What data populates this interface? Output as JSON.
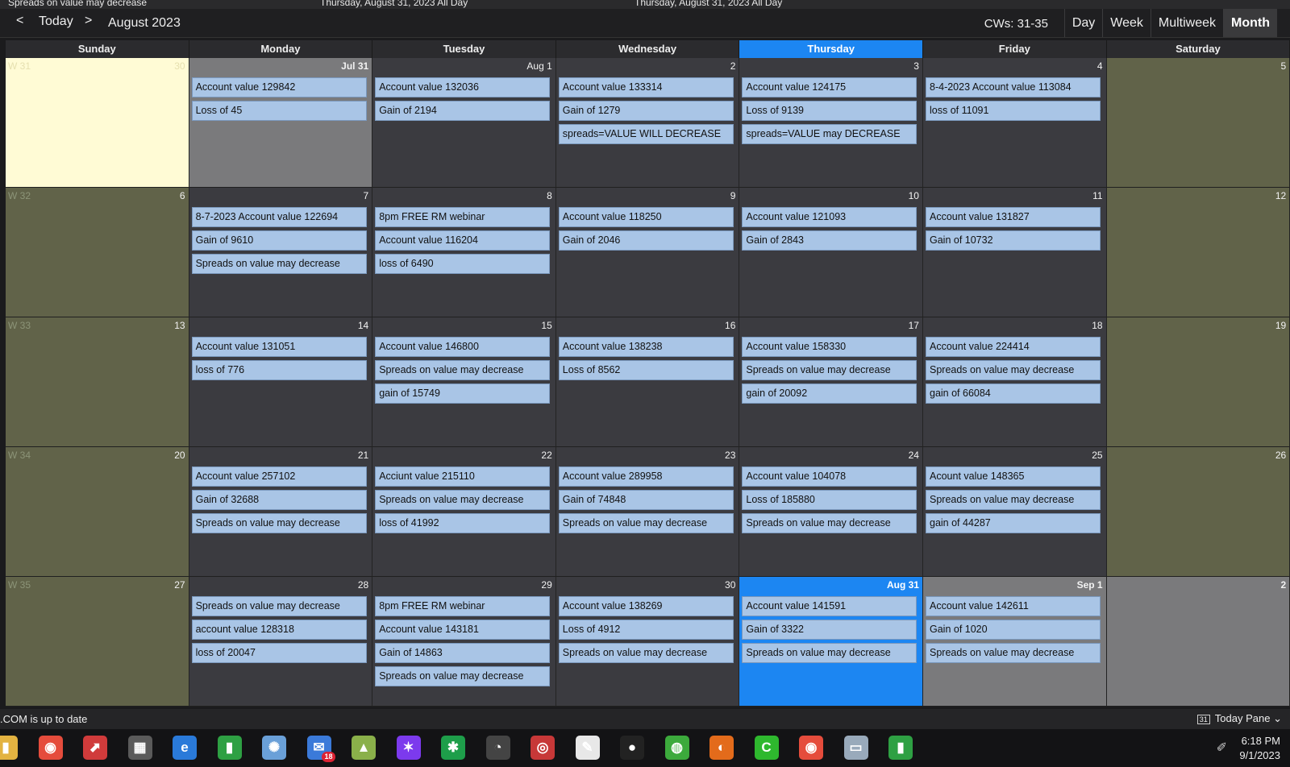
{
  "top_strip": [
    "Spreads on value may decrease",
    "Thursday, August 31, 2023 All Day",
    "Thursday, August 31, 2023 All Day"
  ],
  "nav": {
    "prev": "<",
    "today": "Today",
    "next": ">",
    "month_title": "August 2023",
    "cws": "CWs: 31-35"
  },
  "views": [
    "Day",
    "Week",
    "Multiweek",
    "Month"
  ],
  "active_view": "Month",
  "day_headers": [
    "Sunday",
    "Monday",
    "Tuesday",
    "Wednesday",
    "Thursday",
    "Friday",
    "Saturday"
  ],
  "today_column": "Thursday",
  "colors": {
    "today": "#1c86f2",
    "event": "#a9c5e6",
    "weekend": "#616349",
    "other_month": "#7a7a7c",
    "weekday": "#3b3b40",
    "today_fill": "#fffbd5"
  },
  "weeks": [
    {
      "label": "W 31",
      "days": [
        {
          "date": "30",
          "state": "other-today",
          "events": []
        },
        {
          "date": "Jul 31",
          "state": "other",
          "events": [
            "Account value 129842",
            "Loss of 45"
          ]
        },
        {
          "date": "Aug 1",
          "state": "normal",
          "events": [
            "Account value 132036",
            "Gain of 2194"
          ]
        },
        {
          "date": "2",
          "state": "normal",
          "events": [
            "Account value 133314",
            "Gain of 1279",
            "spreads=VALUE WILL DECREASE"
          ]
        },
        {
          "date": "3",
          "state": "normal",
          "events": [
            "Account value 124175",
            "Loss of 9139",
            "spreads=VALUE may DECREASE"
          ]
        },
        {
          "date": "4",
          "state": "normal",
          "events": [
            "8-4-2023 Account value 113084",
            "loss of 11091"
          ]
        },
        {
          "date": "5",
          "state": "weekend",
          "events": []
        }
      ]
    },
    {
      "label": "W 32",
      "days": [
        {
          "date": "6",
          "state": "weekend",
          "events": []
        },
        {
          "date": "7",
          "state": "normal",
          "events": [
            "8-7-2023 Account value 122694",
            "Gain of 9610",
            "Spreads on value may decrease"
          ]
        },
        {
          "date": "8",
          "state": "normal",
          "events": [
            "8pm FREE RM webinar",
            "Account value 116204",
            "loss of 6490"
          ]
        },
        {
          "date": "9",
          "state": "normal",
          "events": [
            "Account value 118250",
            "Gain of 2046"
          ]
        },
        {
          "date": "10",
          "state": "normal",
          "events": [
            "Account value 121093",
            "Gain of 2843"
          ]
        },
        {
          "date": "11",
          "state": "normal",
          "events": [
            "Account value 131827",
            "Gain of 10732"
          ]
        },
        {
          "date": "12",
          "state": "weekend",
          "events": []
        }
      ]
    },
    {
      "label": "W 33",
      "days": [
        {
          "date": "13",
          "state": "weekend",
          "events": []
        },
        {
          "date": "14",
          "state": "normal",
          "events": [
            "Account value 131051",
            "loss of 776"
          ]
        },
        {
          "date": "15",
          "state": "normal",
          "events": [
            "Account value 146800",
            "Spreads on value may decrease",
            "gain of 15749"
          ]
        },
        {
          "date": "16",
          "state": "normal",
          "events": [
            "Account value 138238",
            "Loss of 8562"
          ]
        },
        {
          "date": "17",
          "state": "normal",
          "events": [
            "Account value 158330",
            "Spreads on value may decrease",
            "gain of 20092"
          ]
        },
        {
          "date": "18",
          "state": "normal",
          "events": [
            "Account value 224414",
            "Spreads on value may decrease",
            "gain of 66084"
          ]
        },
        {
          "date": "19",
          "state": "weekend",
          "events": []
        }
      ]
    },
    {
      "label": "W 34",
      "days": [
        {
          "date": "20",
          "state": "weekend",
          "events": []
        },
        {
          "date": "21",
          "state": "normal",
          "events": [
            "Account value 257102",
            "Gain of 32688",
            "Spreads on value may decrease"
          ]
        },
        {
          "date": "22",
          "state": "normal",
          "events": [
            "Acciunt value 215110",
            "Spreads on value may decrease",
            "loss of 41992"
          ]
        },
        {
          "date": "23",
          "state": "normal",
          "events": [
            "Account value 289958",
            "Gain of 74848",
            "Spreads on value may decrease"
          ]
        },
        {
          "date": "24",
          "state": "normal",
          "events": [
            "Account value 104078",
            "Loss of 185880",
            "Spreads on value may decrease"
          ]
        },
        {
          "date": "25",
          "state": "normal",
          "events": [
            "Acount value 148365",
            "Spreads on value may decrease",
            "gain of 44287"
          ]
        },
        {
          "date": "26",
          "state": "weekend",
          "events": []
        }
      ]
    },
    {
      "label": "W 35",
      "days": [
        {
          "date": "27",
          "state": "weekend",
          "events": []
        },
        {
          "date": "28",
          "state": "normal",
          "events": [
            "Spreads on value may decrease",
            "account value 128318",
            "loss of 20047"
          ]
        },
        {
          "date": "29",
          "state": "normal",
          "events": [
            "8pm FREE RM webinar",
            "Account value 143181",
            "Gain of 14863",
            "Spreads on value may decrease"
          ]
        },
        {
          "date": "30",
          "state": "normal",
          "events": [
            "Account value 138269",
            "Loss of 4912",
            "Spreads on value may decrease"
          ]
        },
        {
          "date": "Aug 31",
          "state": "today",
          "events": [
            "Account value 141591",
            "Gain of 3322",
            "Spreads on value may decrease"
          ]
        },
        {
          "date": "Sep 1",
          "state": "other",
          "events": [
            "Account value 142611",
            "Gain of 1020",
            "Spreads on value may decrease"
          ]
        },
        {
          "date": "2",
          "state": "other",
          "events": []
        }
      ]
    }
  ],
  "status": {
    "message": ".COM is up to date",
    "today_pane": "Today Pane",
    "today_pane_icon": "calendar-31-icon"
  },
  "taskbar": {
    "apps": [
      {
        "name": "file-explorer-icon",
        "glyph": "▮",
        "color": "#e3b341"
      },
      {
        "name": "chrome-icon",
        "glyph": "◉",
        "color": "#e54c3c"
      },
      {
        "name": "pdf-app-icon",
        "glyph": "⬈",
        "color": "#d03b3b"
      },
      {
        "name": "calendar-321-icon",
        "glyph": "▦",
        "color": "#5a5a5a"
      },
      {
        "name": "edge-icon",
        "glyph": "e",
        "color": "#2a7ad9"
      },
      {
        "name": "trading-chart-icon",
        "glyph": "▮",
        "color": "#2ea043"
      },
      {
        "name": "brain-app-icon",
        "glyph": "✺",
        "color": "#6aa0d8"
      },
      {
        "name": "thunderbird-icon",
        "glyph": "✉",
        "color": "#3b7ad9"
      },
      {
        "name": "map-app-icon",
        "glyph": "▲",
        "color": "#8ab04a"
      },
      {
        "name": "puzzle-app-icon",
        "glyph": "✶",
        "color": "#7c3aed"
      },
      {
        "name": "green-star-icon",
        "glyph": "✱",
        "color": "#1e9e4a"
      },
      {
        "name": "speedometer-icon",
        "glyph": "◔",
        "color": "#444"
      },
      {
        "name": "shield-icon",
        "glyph": "◎",
        "color": "#c73838"
      },
      {
        "name": "acrobat-icon",
        "glyph": "✎",
        "color": "#e8e8e8"
      },
      {
        "name": "bulb-icon",
        "glyph": "●",
        "color": "#222"
      },
      {
        "name": "green-globe-icon",
        "glyph": "◍",
        "color": "#3caa3c"
      },
      {
        "name": "color-wheel-icon",
        "glyph": "◐",
        "color": "#e36b1b"
      },
      {
        "name": "c-app-icon",
        "glyph": "C",
        "color": "#2eb82e"
      },
      {
        "name": "chrome-alt-icon",
        "glyph": "◉",
        "color": "#e54c3c"
      },
      {
        "name": "monitor-app-icon",
        "glyph": "▭",
        "color": "#9ab"
      },
      {
        "name": "trading-chart-alt-icon",
        "glyph": "▮",
        "color": "#2ea043"
      }
    ],
    "badge": "18",
    "tray_icon": "pen-icon",
    "time": "6:18 PM",
    "date": "9/1/2023"
  }
}
